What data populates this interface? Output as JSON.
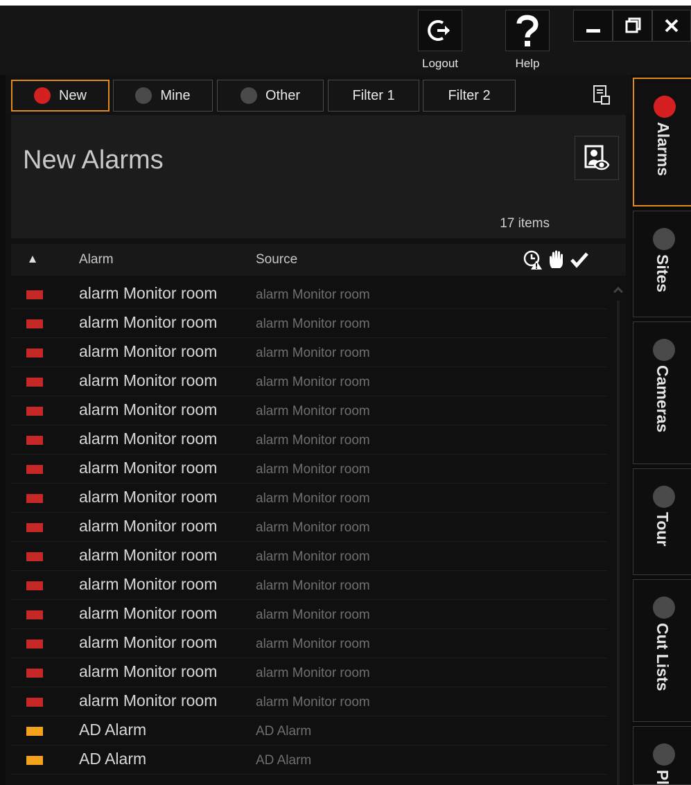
{
  "toolbar": {
    "logout_label": "Logout",
    "help_label": "Help"
  },
  "filters": [
    {
      "label": "New",
      "indicator": "red",
      "active": true
    },
    {
      "label": "Mine",
      "indicator": "gray",
      "active": false
    },
    {
      "label": "Other",
      "indicator": "gray",
      "active": false
    },
    {
      "label": "Filter 1",
      "active": false
    },
    {
      "label": "Filter 2",
      "active": false
    }
  ],
  "header": {
    "title": "New Alarms",
    "count": "17 items"
  },
  "columns": {
    "alarm": "Alarm",
    "source": "Source"
  },
  "rows": [
    {
      "alarm": "alarm Monitor room",
      "source": "alarm Monitor room",
      "color": "#c62828"
    },
    {
      "alarm": "alarm Monitor room",
      "source": "alarm Monitor room",
      "color": "#c62828"
    },
    {
      "alarm": "alarm Monitor room",
      "source": "alarm Monitor room",
      "color": "#c62828"
    },
    {
      "alarm": "alarm Monitor room",
      "source": "alarm Monitor room",
      "color": "#c62828"
    },
    {
      "alarm": "alarm Monitor room",
      "source": "alarm Monitor room",
      "color": "#c62828"
    },
    {
      "alarm": "alarm Monitor room",
      "source": "alarm Monitor room",
      "color": "#c62828"
    },
    {
      "alarm": "alarm Monitor room",
      "source": "alarm Monitor room",
      "color": "#c62828"
    },
    {
      "alarm": "alarm Monitor room",
      "source": "alarm Monitor room",
      "color": "#c62828"
    },
    {
      "alarm": "alarm Monitor room",
      "source": "alarm Monitor room",
      "color": "#c62828"
    },
    {
      "alarm": "alarm Monitor room",
      "source": "alarm Monitor room",
      "color": "#c62828"
    },
    {
      "alarm": "alarm Monitor room",
      "source": "alarm Monitor room",
      "color": "#c62828"
    },
    {
      "alarm": "alarm Monitor room",
      "source": "alarm Monitor room",
      "color": "#c62828"
    },
    {
      "alarm": "alarm Monitor room",
      "source": "alarm Monitor room",
      "color": "#c62828"
    },
    {
      "alarm": "alarm Monitor room",
      "source": "alarm Monitor room",
      "color": "#c62828"
    },
    {
      "alarm": "alarm Monitor room",
      "source": "alarm Monitor room",
      "color": "#c62828"
    },
    {
      "alarm": "AD Alarm",
      "source": "AD Alarm",
      "color": "#f4a21c"
    },
    {
      "alarm": "AD Alarm",
      "source": "AD Alarm",
      "color": "#f4a21c"
    }
  ],
  "tabs": [
    {
      "label": "Alarms",
      "indicator": "red",
      "active": true
    },
    {
      "label": "Sites",
      "indicator": "gray",
      "active": false
    },
    {
      "label": "Cameras",
      "indicator": "gray",
      "active": false
    },
    {
      "label": "Tour",
      "indicator": "gray",
      "active": false
    },
    {
      "label": "Cut Lists",
      "indicator": "gray",
      "active": false
    },
    {
      "label": "Pl",
      "indicator": "gray",
      "active": false
    }
  ],
  "colors": {
    "accent": "#e08b1a",
    "alarm_red": "#d42020",
    "background": "#0c0c0c"
  }
}
